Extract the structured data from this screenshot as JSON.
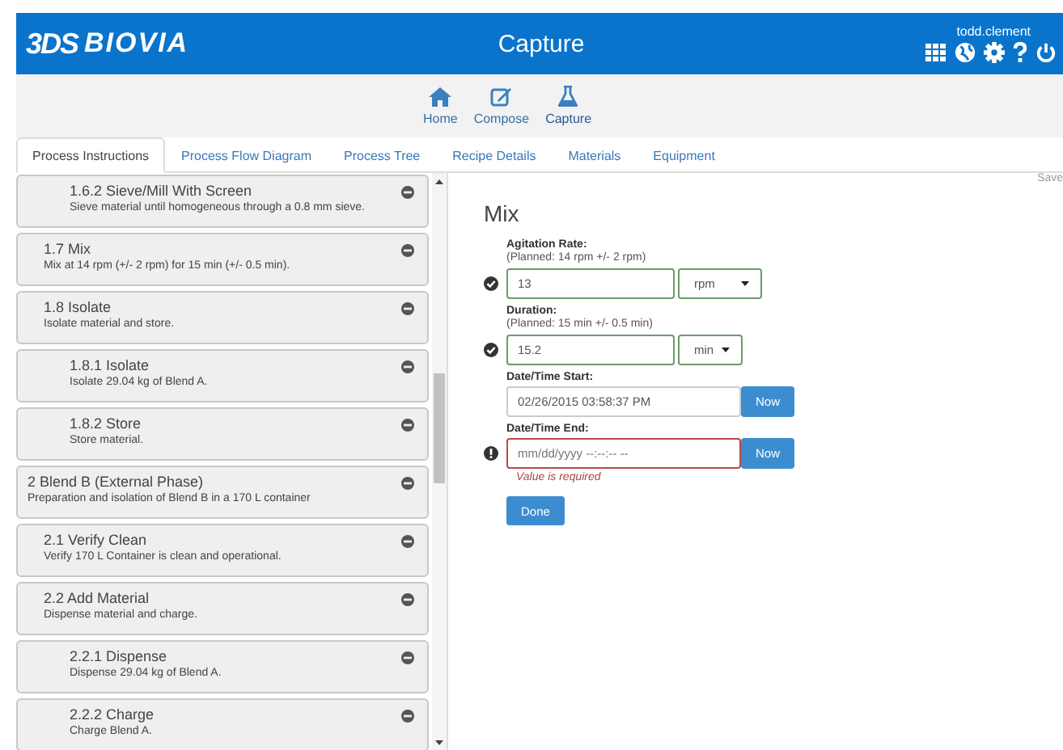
{
  "header": {
    "logo_mark": "3DS",
    "logo_text": "BIOVIA",
    "title": "Capture",
    "user": "todd.clement"
  },
  "nav": [
    {
      "label": "Home",
      "selected": false
    },
    {
      "label": "Compose",
      "selected": false
    },
    {
      "label": "Capture",
      "selected": true
    }
  ],
  "tabs": [
    {
      "label": "Process Instructions",
      "selected": true
    },
    {
      "label": "Process Flow Diagram",
      "selected": false
    },
    {
      "label": "Process Tree",
      "selected": false
    },
    {
      "label": "Recipe Details",
      "selected": false
    },
    {
      "label": "Materials",
      "selected": false
    },
    {
      "label": "Equipment",
      "selected": false
    }
  ],
  "outline": [
    {
      "children": [
        {
          "children": [
            {
              "title": "1.6.2 Sieve/Mill With Screen",
              "description": "Sieve material until homogeneous through a 0.8 mm sieve."
            }
          ]
        },
        {
          "title": "1.7 Mix",
          "description": "Mix at 14 rpm (+/- 2 rpm) for 15 min (+/- 0.5 min)."
        },
        {
          "title": "1.8 Isolate",
          "description": "Isolate material and store.",
          "children": [
            {
              "title": "1.8.1 Isolate",
              "description": "Isolate 29.04 kg of Blend A."
            },
            {
              "title": "1.8.2 Store",
              "description": "Store material."
            }
          ]
        }
      ]
    },
    {
      "title": "2 Blend B (External Phase)",
      "description": "Preparation and isolation of Blend B in a 170 L container",
      "children": [
        {
          "title": "2.1 Verify Clean",
          "description": "Verify 170 L Container is clean and operational."
        },
        {
          "title": "2.2 Add Material",
          "description": "Dispense material and charge.",
          "children": [
            {
              "title": "2.2.1 Dispense",
              "description": "Dispense 29.04 kg of Blend A."
            },
            {
              "title": "2.2.2 Charge",
              "description": "Charge Blend A."
            }
          ]
        }
      ]
    }
  ],
  "form": {
    "save": "Save",
    "title": "Mix",
    "fields": [
      {
        "kind": "measure",
        "label": "Agitation Rate:",
        "planned": "(Planned: 14 rpm +/- 2 rpm)",
        "valid": true,
        "invalid": false,
        "value": "13",
        "unit": "rpm"
      },
      {
        "kind": "measure",
        "label": "Duration:",
        "planned": "(Planned: 15 min +/- 0.5 min)",
        "valid": true,
        "invalid": false,
        "value": "15.2",
        "unit": "min"
      },
      {
        "kind": "datetime",
        "label": "Date/Time Start:",
        "valid": false,
        "invalid": false,
        "value": "02/26/2015 03:58:37 PM",
        "button": "Now"
      },
      {
        "kind": "datetime",
        "label": "Date/Time End:",
        "valid": false,
        "invalid": true,
        "placeholder": "mm/dd/yyyy --:--:-- --",
        "button": "Now",
        "error": "Value is required"
      }
    ],
    "done": "Done"
  }
}
